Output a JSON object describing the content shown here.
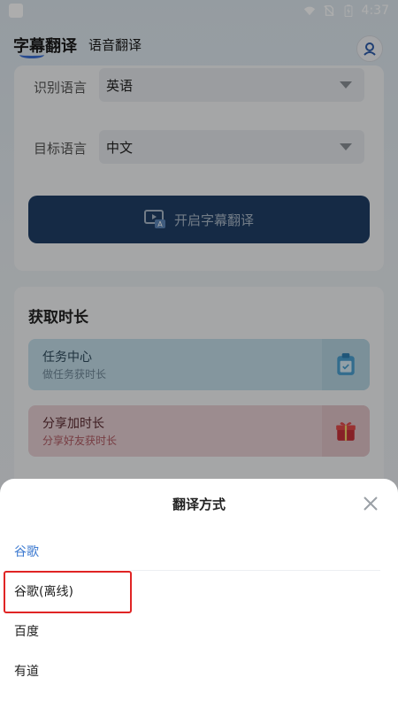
{
  "status_bar": {
    "time": "4:37",
    "icons": [
      "notification-square-icon",
      "wifi-icon",
      "no-sim-icon",
      "battery-charging-icon"
    ]
  },
  "top_nav": {
    "tabs": [
      {
        "label": "字幕翻译",
        "active": true
      },
      {
        "label": "语音翻译",
        "active": false
      }
    ],
    "avatar_icon": "user-icon"
  },
  "settings_card": {
    "recognize_language_label": "识别语言",
    "recognize_language_value": "英语",
    "target_language_label": "目标语言",
    "target_language_value": "中文",
    "start_button_label": "开启字幕翻译",
    "start_button_icon": "subtitle-screen-icon"
  },
  "time_card": {
    "title": "获取时长",
    "items": [
      {
        "title": "任务中心",
        "subtitle": "做任务获时长",
        "icon": "clipboard-icon",
        "color": "#4db6e8"
      },
      {
        "title": "分享加时长",
        "subtitle": "分享好友获时长",
        "icon": "gift-icon",
        "color": "#e24a4a"
      }
    ]
  },
  "sheet": {
    "title": "翻译方式",
    "close_icon": "close-icon",
    "options": [
      {
        "label": "谷歌",
        "selected": true
      },
      {
        "label": "谷歌(离线)",
        "selected": false
      },
      {
        "label": "百度",
        "selected": false
      },
      {
        "label": "有道",
        "selected": false
      }
    ],
    "accent_color": "#3d7ad0",
    "highlight_color": "#e02424"
  }
}
